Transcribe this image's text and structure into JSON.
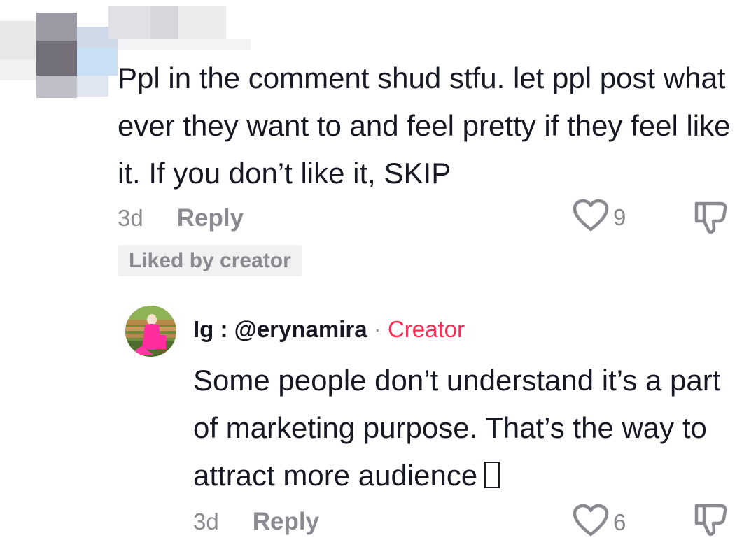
{
  "parent_comment": {
    "text": "Ppl in the comment shud stfu. let ppl post what ever they want to and feel pretty if they feel like it. If you don’t like it, SKIP",
    "time": "3d",
    "reply_label": "Reply",
    "like_count": "9",
    "badge": "Liked by creator"
  },
  "reply_comment": {
    "username": "Ig : @erynamira",
    "separator": "·",
    "tag": "Creator",
    "text": "Some people don’t understand it’s a part of marketing purpose. That’s the way to attract more audience",
    "time": "3d",
    "reply_label": "Reply",
    "like_count": "6"
  },
  "icons": {
    "like": "heart-outline-icon",
    "dislike": "thumbs-down-outline-icon"
  },
  "colors": {
    "primary_text": "#161823",
    "secondary_text": "#8a8b91",
    "creator_accent": "#fe2c55",
    "badge_bg": "#f1f1f2"
  }
}
